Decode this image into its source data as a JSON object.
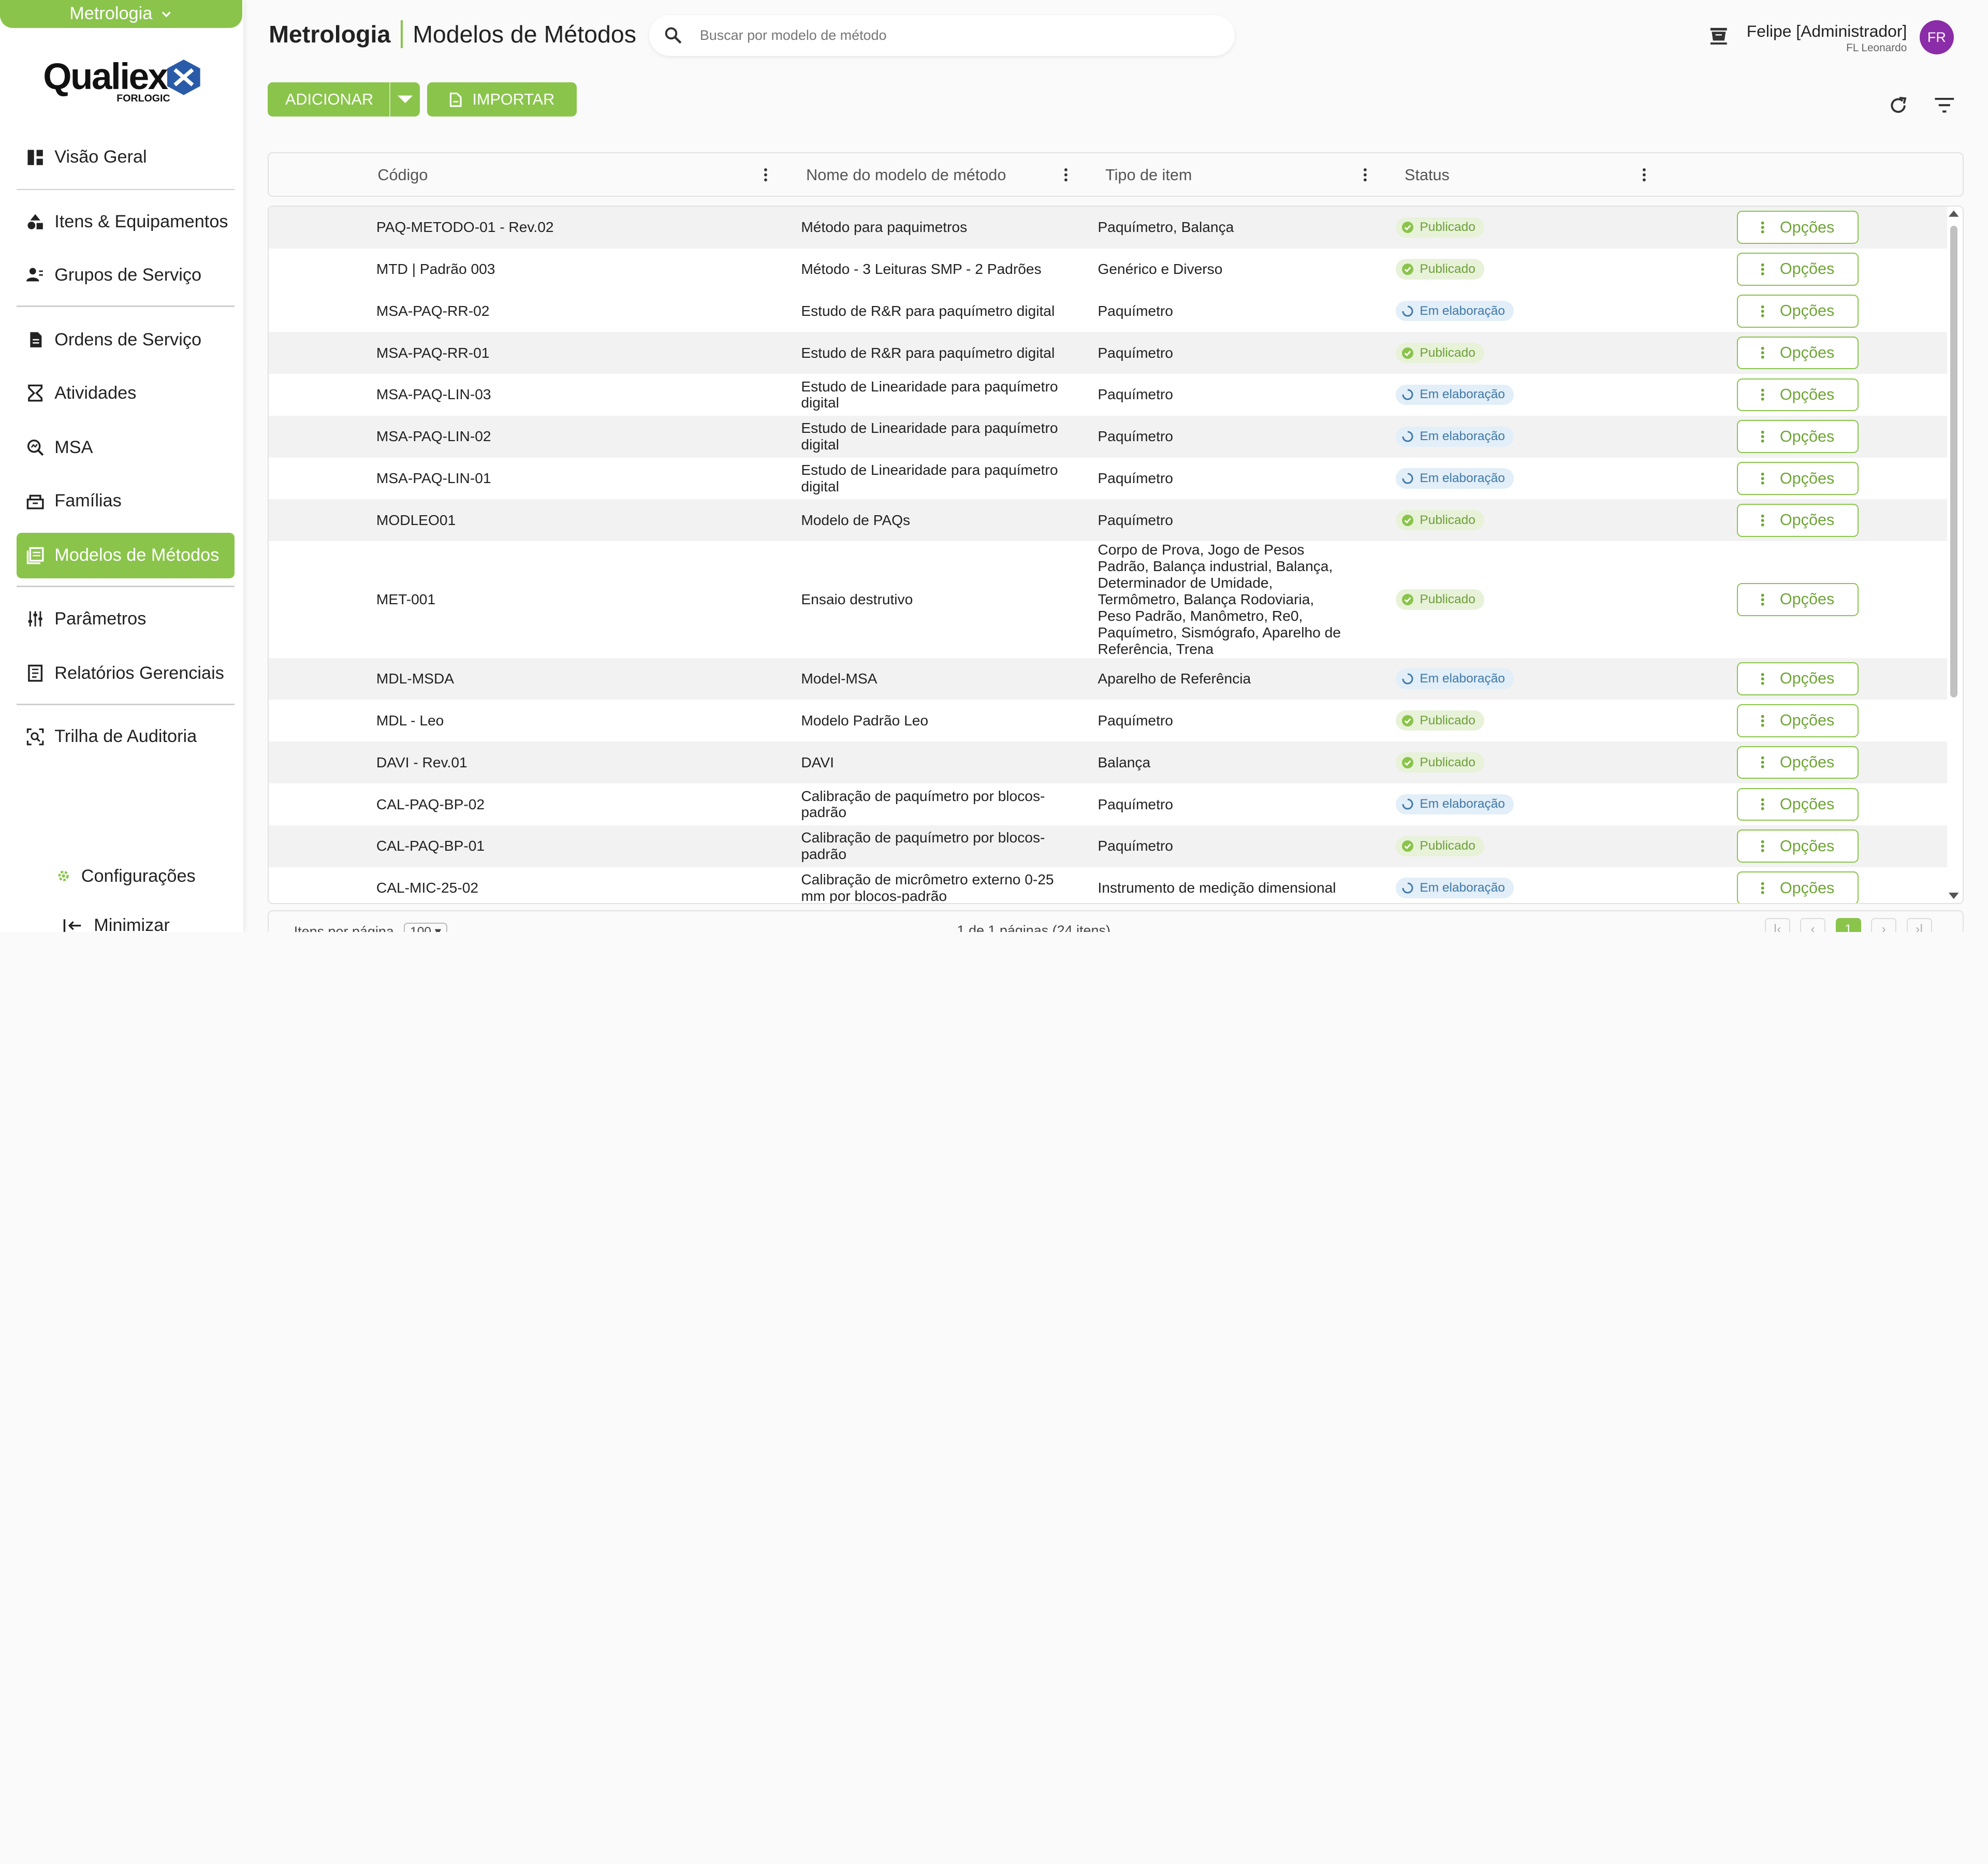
{
  "sidebar": {
    "module": "Metrologia",
    "logo_text": "Qualiex",
    "logo_sub": "FORLOGIC",
    "items": [
      {
        "label": "Visão Geral"
      },
      {
        "label": "Itens & Equipamentos"
      },
      {
        "label": "Grupos de Serviço"
      },
      {
        "label": "Ordens de Serviço"
      },
      {
        "label": "Atividades"
      },
      {
        "label": "MSA"
      },
      {
        "label": "Famílias"
      },
      {
        "label": "Modelos de Métodos"
      },
      {
        "label": "Parâmetros"
      },
      {
        "label": "Relatórios Gerenciais"
      },
      {
        "label": "Trilha de Auditoria"
      }
    ],
    "config_label": "Configurações",
    "minimize_label": "Minimizar"
  },
  "header": {
    "module": "Metrologia",
    "page": "Modelos de Métodos",
    "search_placeholder": "Buscar por modelo de método",
    "user_name": "Felipe [Administrador]",
    "user_org": "FL Leonardo",
    "avatar": "FR"
  },
  "actions": {
    "add_label": "ADICIONAR",
    "import_label": "IMPORTAR"
  },
  "table": {
    "columns": [
      "Código",
      "Nome do modelo de método",
      "Tipo de item",
      "Status"
    ],
    "options_label": "Opções",
    "rows": [
      {
        "code": "PAQ-METODO-01 - Rev.02",
        "name": "Método para paquimetros",
        "type": "Paquímetro, Balança",
        "status": "Publicado"
      },
      {
        "code": "MTD | Padrão 003",
        "name": "Método - 3 Leituras SMP - 2 Padrões",
        "type": "Genérico e Diverso",
        "status": "Publicado"
      },
      {
        "code": "MSA-PAQ-RR-02",
        "name": "Estudo de R&R para paquímetro digital",
        "type": "Paquímetro",
        "status": "Em elaboração"
      },
      {
        "code": "MSA-PAQ-RR-01",
        "name": "Estudo de R&R para paquímetro digital",
        "type": "Paquímetro",
        "status": "Publicado"
      },
      {
        "code": "MSA-PAQ-LIN-03",
        "name": "Estudo de Linearidade para paquímetro digital",
        "type": "Paquímetro",
        "status": "Em elaboração"
      },
      {
        "code": "MSA-PAQ-LIN-02",
        "name": "Estudo de Linearidade para paquímetro digital",
        "type": "Paquímetro",
        "status": "Em elaboração"
      },
      {
        "code": "MSA-PAQ-LIN-01",
        "name": "Estudo de Linearidade para paquímetro digital",
        "type": "Paquímetro",
        "status": "Em elaboração"
      },
      {
        "code": "MODLEO01",
        "name": "Modelo de PAQs",
        "type": "Paquímetro",
        "status": "Publicado"
      },
      {
        "code": "MET-001",
        "name": "Ensaio destrutivo",
        "type": "Corpo de Prova, Jogo de Pesos Padrão, Balança industrial, Balança, Determinador de Umidade, Termômetro, Balança Rodoviaria, Peso Padrão, Manômetro, Re0, Paquímetro, Sismógrafo, Aparelho de Referência, Trena",
        "status": "Publicado"
      },
      {
        "code": "MDL-MSDA",
        "name": "Model-MSA",
        "type": "Aparelho de Referência",
        "status": "Em elaboração"
      },
      {
        "code": "MDL - Leo",
        "name": "Modelo Padrão Leo",
        "type": "Paquímetro",
        "status": "Publicado"
      },
      {
        "code": "DAVI - Rev.01",
        "name": "DAVI",
        "type": "Balança",
        "status": "Publicado"
      },
      {
        "code": "CAL-PAQ-BP-02",
        "name": "Calibração de paquímetro por blocos-padrão",
        "type": "Paquímetro",
        "status": "Em elaboração"
      },
      {
        "code": "CAL-PAQ-BP-01",
        "name": "Calibração de paquímetro por blocos-padrão",
        "type": "Paquímetro",
        "status": "Publicado"
      },
      {
        "code": "CAL-MIC-25-02",
        "name": "Calibração de micrômetro externo 0-25 mm por blocos-padrão",
        "type": "Instrumento de medição dimensional",
        "status": "Em elaboração"
      }
    ]
  },
  "footer": {
    "items_per_page_label": "Itens por página",
    "items_per_page": "100",
    "page_info": "1 de 1 páginas (24 itens)",
    "current_page": "1"
  },
  "colors": {
    "accent": "#8ac44b",
    "published_bg": "#e7f2d9",
    "draft_bg": "#e2eef8",
    "avatar": "#8b2ca8"
  }
}
